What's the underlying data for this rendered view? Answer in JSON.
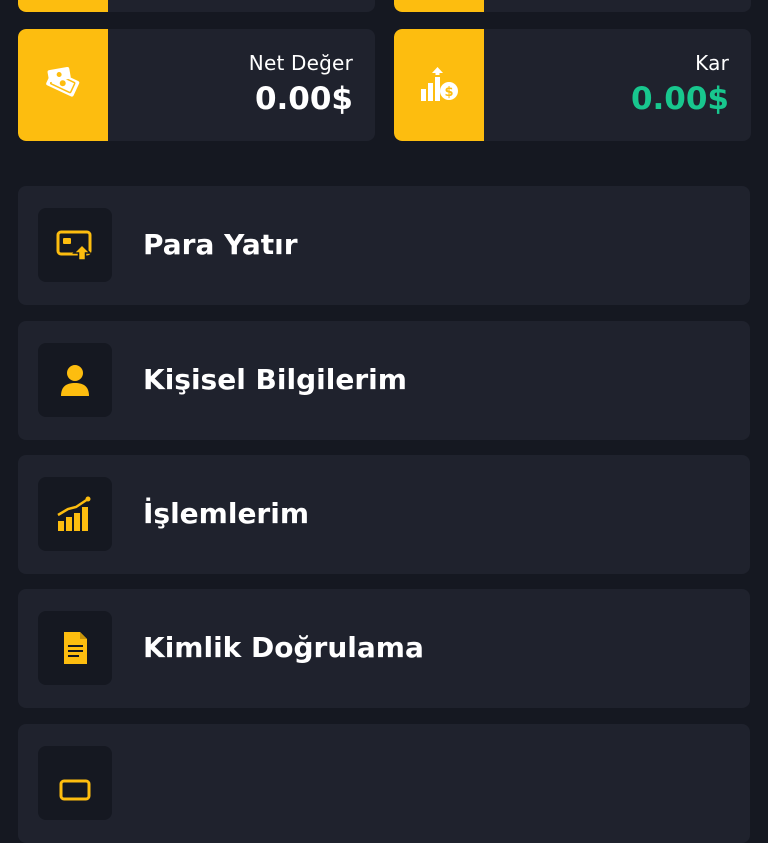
{
  "stats": {
    "net_worth": {
      "label": "Net Değer",
      "value": "0.00$"
    },
    "profit": {
      "label": "Kar",
      "value": "0.00$"
    }
  },
  "menu": {
    "items": [
      {
        "label": "Para Yatır",
        "icon": "deposit-icon"
      },
      {
        "label": "Kişisel Bilgilerim",
        "icon": "user-icon"
      },
      {
        "label": "İşlemlerim",
        "icon": "chart-icon"
      },
      {
        "label": "Kimlik Doğrulama",
        "icon": "document-icon"
      }
    ]
  },
  "colors": {
    "background": "#151821",
    "card": "#1f222d",
    "accent": "#fdbd0f",
    "positive": "#18c78e",
    "text": "#ffffff"
  }
}
